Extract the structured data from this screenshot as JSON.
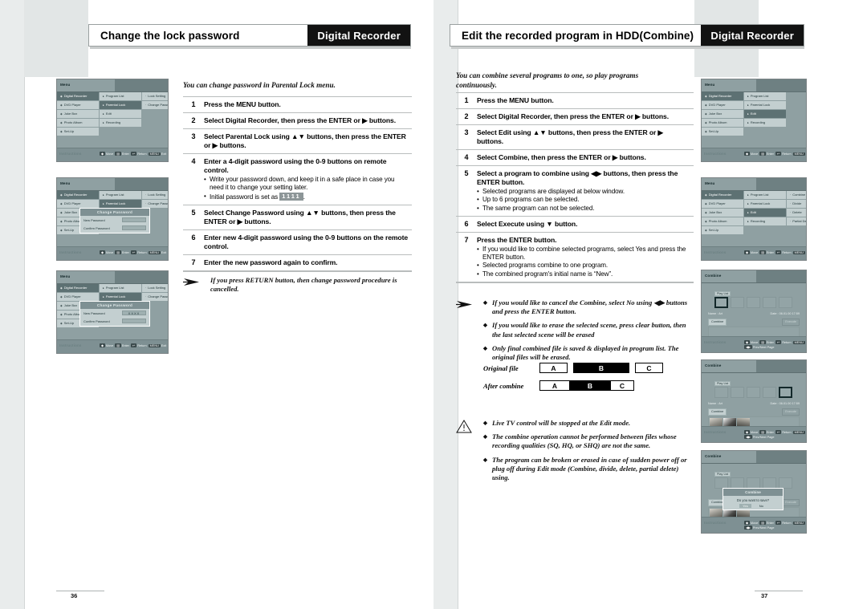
{
  "left_page": {
    "folio": "36",
    "header": {
      "title": "Change the lock password",
      "brand": "Digital Recorder"
    },
    "intro": "You can change password in Parental Lock menu.",
    "steps": [
      {
        "num": "1",
        "text": "Press the MENU button.",
        "bullets": []
      },
      {
        "num": "2",
        "text": "Select Digital Recorder, then press the ENTER or ▶ buttons.",
        "bullets": []
      },
      {
        "num": "3",
        "text": "Select Parental Lock using ▲▼ buttons, then press the ENTER or ▶ buttons.",
        "bullets": []
      },
      {
        "num": "4",
        "text": "Enter a 4-digit password using the 0-9 buttons on remote control.",
        "bullets": [
          "Write your password down, and keep it in a safe place in case you need it to change your setting later.",
          "Initial password is set as 1111 ."
        ]
      },
      {
        "num": "5",
        "text": "Select Change Password using ▲▼ buttons, then press the ENTER or ▶ buttons.",
        "bullets": []
      },
      {
        "num": "6",
        "text": "Enter new 4-digit password using the 0-9 buttons on the remote control.",
        "bullets": []
      },
      {
        "num": "7",
        "text": "Enter the new password again to confirm.",
        "bullets": []
      }
    ],
    "note": "If you press RETURN button, then change password procedure is cancelled.",
    "initial_password_key": "1111",
    "screens": [
      {
        "title": "Menu",
        "col1": [
          "Digital Recorder",
          "DVD Player",
          "Juke Box",
          "Photo Album",
          "Set-Up"
        ],
        "col1_selected": 0,
        "col2": [
          "Program List",
          "Parental Lock",
          "Edit",
          "Recording"
        ],
        "col2_selected": 1,
        "col3": [
          "Lock Setting",
          "Change Password"
        ],
        "col3_selected": -1,
        "instructions_word": "Instructions",
        "keys": "Move   Enter   Return   Exit"
      },
      {
        "title": "Menu",
        "col1": [
          "Digital Recorder",
          "DVD Player",
          "Juke Box",
          "Photo Album",
          "Set-Up"
        ],
        "col1_selected": 0,
        "col2": [
          "Program List",
          "Parental Lock",
          "Edit",
          "Recording"
        ],
        "col2_selected": 1,
        "col3": [
          "Lock Setting",
          "Change Password"
        ],
        "col3_selected": -1,
        "dialog": {
          "title": "Change Password",
          "new_label": "New Password",
          "new_value": "",
          "confirm_label": "Confirm Password",
          "confirm_value": ""
        },
        "instructions_word": "Instructions",
        "keys": "Move   Enter   Return   Exit"
      },
      {
        "title": "Menu",
        "col1": [
          "Digital Recorder",
          "DVD Player",
          "Juke Box",
          "Photo Album",
          "Set-Up"
        ],
        "col1_selected": 0,
        "col2": [
          "Program List",
          "Parental Lock",
          "Edit",
          "Recording"
        ],
        "col2_selected": 1,
        "col3": [
          "Lock Setting",
          "Change Password"
        ],
        "col3_selected": -1,
        "dialog": {
          "title": "Change Password",
          "new_label": "New Password",
          "new_value": "XXXX",
          "confirm_label": "Confirm Password",
          "confirm_value": ""
        },
        "instructions_word": "Instructions",
        "keys": "Move   Enter   Return   Exit"
      }
    ]
  },
  "right_page": {
    "folio": "37",
    "header": {
      "title": "Edit the recorded program in HDD(Combine)",
      "brand": "Digital Recorder"
    },
    "intro": "You can combine several programs to one, so play programs continuously.",
    "steps": [
      {
        "num": "1",
        "text": "Press the MENU button.",
        "bullets": []
      },
      {
        "num": "2",
        "text": "Select Digital Recorder, then press the ENTER or ▶ buttons.",
        "bullets": []
      },
      {
        "num": "3",
        "text": "Select Edit using ▲▼ buttons, then press the ENTER or ▶ buttons.",
        "bullets": []
      },
      {
        "num": "4",
        "text": "Select Combine, then press the ENTER or ▶ buttons.",
        "bullets": []
      },
      {
        "num": "5",
        "text": "Select a program to combine using ◀▶ buttons, then press the ENTER button.",
        "bullets": [
          "Selected programs are displayed at below window.",
          "Up to 6 programs can be selected.",
          "The same program can not be selected."
        ]
      },
      {
        "num": "6",
        "text": "Select Execute using ▼ button.",
        "bullets": []
      },
      {
        "num": "7",
        "text": "Press the ENTER button.",
        "bullets": [
          "If you would like to combine selected programs, select Yes and press the ENTER button.",
          "Selected programs combine to one program.",
          "The combined program's initial name is “New”."
        ]
      }
    ],
    "notes": [
      "If you would like to cancel the Combine, select No using ◀▶ buttons and press the ENTER button.",
      "If you would like to erase the selected scene, press clear button, then the last selected scene will be erased",
      "Only final combined file is saved & displayed in program list. The original files will be erased."
    ],
    "diagram": {
      "row1_label": "Original file",
      "row2_label": "After combine",
      "segments": [
        "A",
        "B",
        "C"
      ]
    },
    "warnings": [
      "Live TV control will be stopped at the Edit mode.",
      "The combine operation cannot be performed between files whose recording qualities (SQ, HQ, or SHQ) are not the same.",
      "The program can be broken or erased in case of sudden power off or plug off during Edit mode (Combine, divide, delete, partial delete) using."
    ],
    "screens": [
      {
        "title": "Menu",
        "col1": [
          "Digital Recorder",
          "DVD Player",
          "Juke Box",
          "Photo Album",
          "Set-Up"
        ],
        "col1_selected": 0,
        "col2": [
          "Program List",
          "Parental Lock",
          "Edit",
          "Recording"
        ],
        "col2_selected": 2,
        "col3": [],
        "instructions_word": "Instructions",
        "keys": "Move   Enter   Return   Exit"
      },
      {
        "title": "Menu",
        "col1": [
          "Digital Recorder",
          "DVD Player",
          "Juke Box",
          "Photo Album",
          "Set-Up"
        ],
        "col1_selected": 0,
        "col2": [
          "Program List",
          "Parental Lock",
          "Edit",
          "Recording"
        ],
        "col2_selected": 2,
        "col3": [
          "Combine",
          "Divide",
          "Delete",
          "Partial Delete"
        ],
        "col3_selected": -1,
        "instructions_word": "Instructions",
        "keys": "Move   Enter   Return   Exit"
      },
      {
        "title": "Combine",
        "playlist_tag": "Play List",
        "name_label": "Name : Art",
        "date_label": "Date : 06.01.00 17:59",
        "btn_combine": "Combine",
        "btn_execute": "Execute",
        "instructions_word": "Instructions",
        "keys": "Move   Enter   Return   Exit",
        "keys2": "Prev/Next Page"
      },
      {
        "title": "Combine",
        "playlist_tag": "Play List",
        "name_label": "Name : Art",
        "date_label": "Date : 06.01.00 17:59",
        "btn_combine": "Combine",
        "btn_execute": "Execute",
        "instructions_word": "Instructions",
        "keys": "Move   Enter   Return   Exit",
        "keys2": "Prev/Next Page"
      },
      {
        "title": "Combine",
        "playlist_tag": "Play List",
        "btn_combine": "Combine",
        "btn_execute": "Execute",
        "confirm": {
          "title": "Combine",
          "question": "Do you want to save?",
          "yes": "Yes",
          "no": "No"
        },
        "instructions_word": "Instructions",
        "keys": "Move   Enter   Return   Exit",
        "keys2": "Prev/Next Page"
      }
    ]
  }
}
